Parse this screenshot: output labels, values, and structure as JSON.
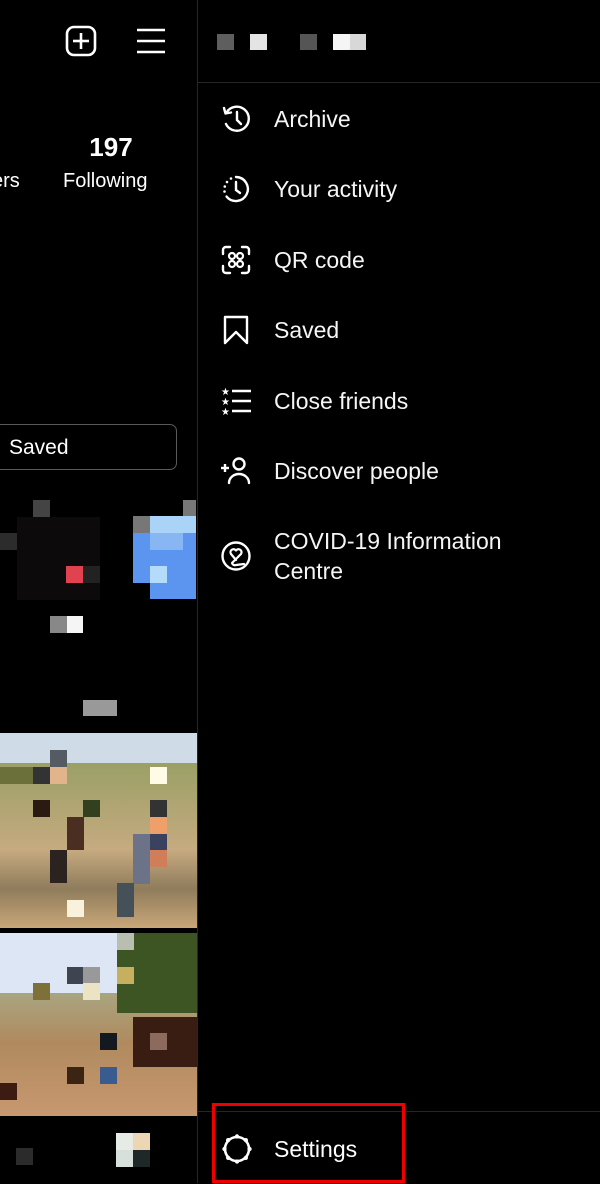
{
  "profile": {
    "followers_label_partial": "ers",
    "following_count": "197",
    "following_label": "Following",
    "saved_tab_label": "Saved",
    "icons": {
      "new_post": "plus-square-icon",
      "menu": "hamburger-menu-icon"
    }
  },
  "drawer": {
    "username": "[pixelated]",
    "menu_items": [
      {
        "label": "Archive",
        "icon": "archive-clock-icon"
      },
      {
        "label": "Your activity",
        "icon": "activity-clock-icon"
      },
      {
        "label": "QR code",
        "icon": "qr-code-icon"
      },
      {
        "label": "Saved",
        "icon": "bookmark-icon"
      },
      {
        "label": "Close friends",
        "icon": "close-friends-list-icon"
      },
      {
        "label": "Discover people",
        "icon": "add-person-icon"
      },
      {
        "label": "COVID-19 Information Centre",
        "icon": "heart-circle-icon"
      }
    ],
    "settings": {
      "label": "Settings",
      "icon": "gear-icon"
    },
    "highlight_color": "#ee0000"
  }
}
